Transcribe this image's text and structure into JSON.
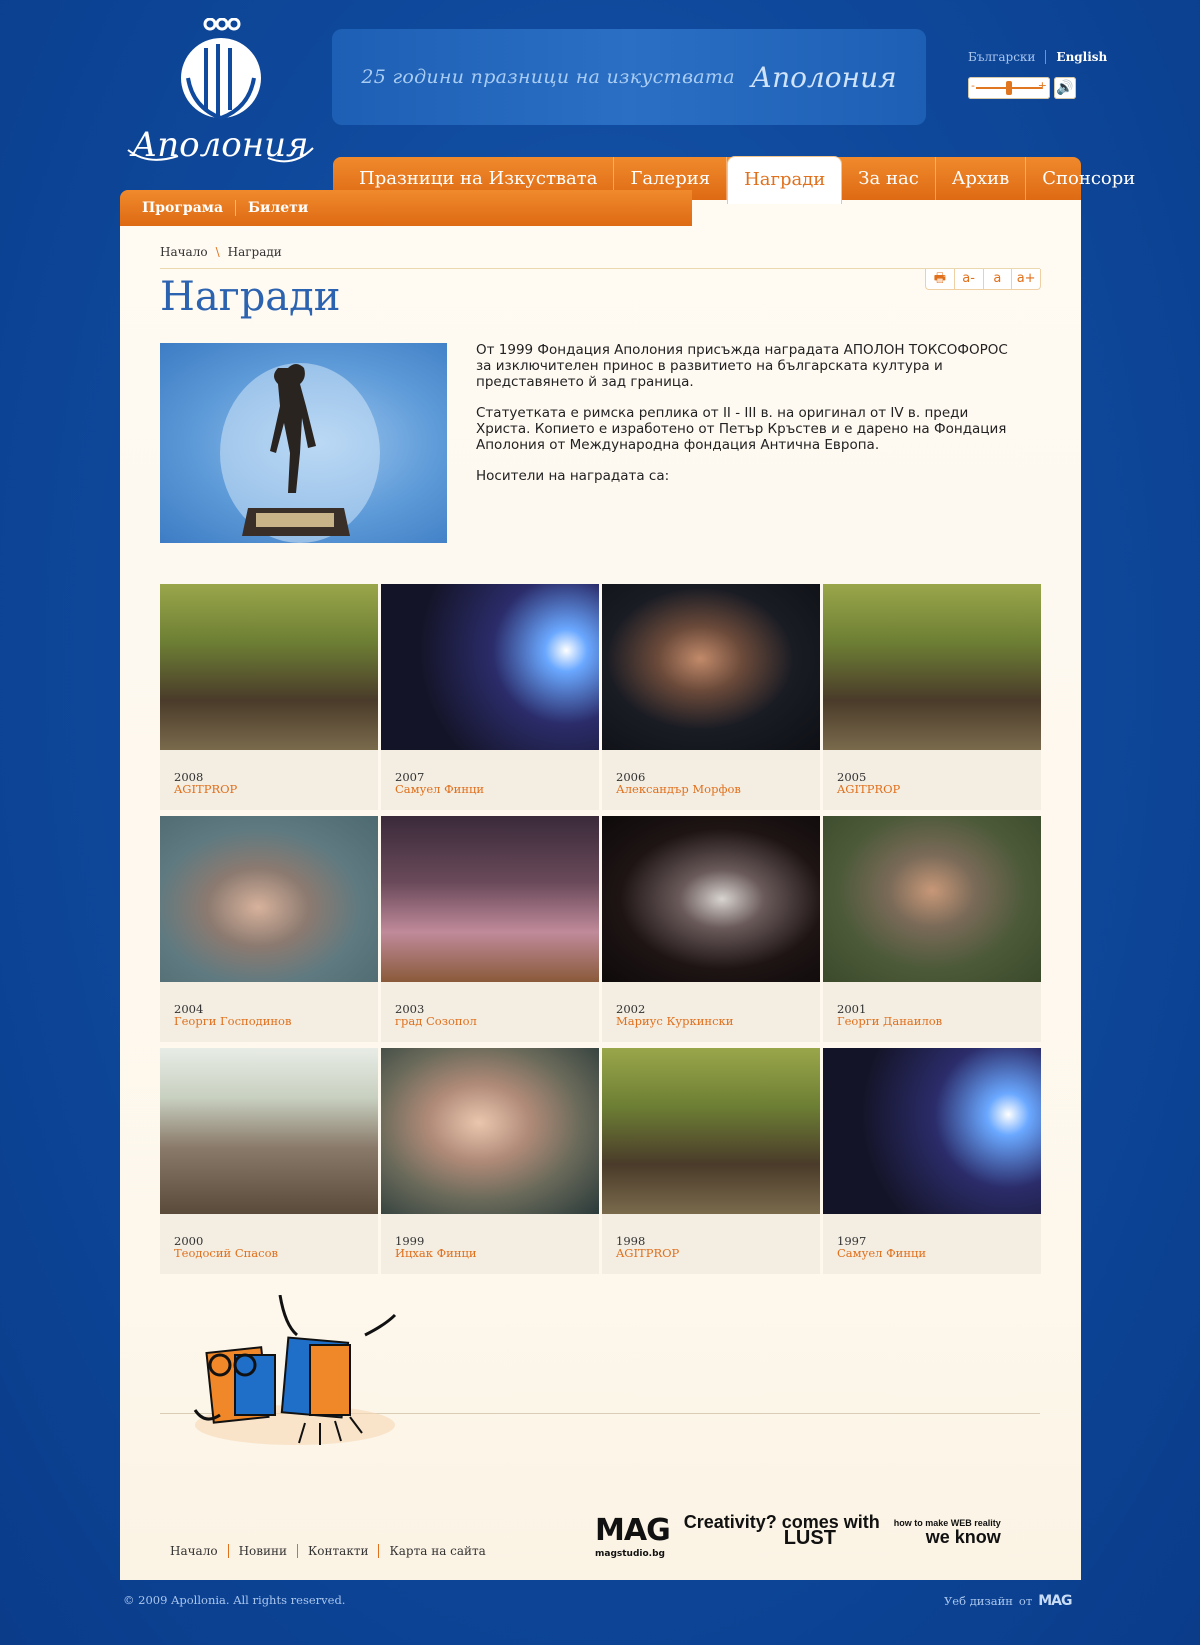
{
  "site": {
    "logo_text": "Аполония",
    "banner_text": "25 години празници на изкуствата",
    "banner_logo": "Аполония"
  },
  "lang": {
    "bg": "Български",
    "en": "English"
  },
  "main_nav": [
    "Празници на Изкуствата",
    "Галерия",
    "Награди",
    "За нас",
    "Архив",
    "Спонсори"
  ],
  "main_nav_active": "Награди",
  "sub_nav": [
    "Програма",
    "Билети"
  ],
  "breadcrumb": {
    "home": "Начало",
    "current": "Награди"
  },
  "tools": {
    "print": "🖶",
    "smaller": "a-",
    "normal": "a",
    "larger": "a+"
  },
  "page": {
    "title": "Награди",
    "p1": "От 1999 Фондация Аполония присъжда наградата АПОЛОН ТОКСОФОРОС за изключителен принос в развитието на българската култура и представянето й зад граница.",
    "p2": "Статуетката е римска реплика от II - III в. на оригинал от IV в. преди Христа. Копието е изработено от Петър Кръстев и е дарено на Фондация Аполония от Международна фондация Антична Европа.",
    "p3": "Носители на наградата са:"
  },
  "awards": [
    {
      "year": "2008",
      "name": "AGITPROP",
      "photo": "group"
    },
    {
      "year": "2007",
      "name": "Самуел Финци",
      "photo": "stage"
    },
    {
      "year": "2006",
      "name": "Александър Морфов",
      "photo": "portrait-dark"
    },
    {
      "year": "2005",
      "name": "AGITPROP",
      "photo": "group"
    },
    {
      "year": "2004",
      "name": "Георги Господинов",
      "photo": "portrait-rock"
    },
    {
      "year": "2003",
      "name": "град Созопол",
      "photo": "ceremony"
    },
    {
      "year": "2002",
      "name": "Мариус Куркински",
      "photo": "handshake"
    },
    {
      "year": "2001",
      "name": "Георги Данаилов",
      "photo": "portrait-green"
    },
    {
      "year": "2000",
      "name": "Теодосий Спасов",
      "photo": "outdoor"
    },
    {
      "year": "1999",
      "name": "Ицхак Финци",
      "photo": "portrait-old"
    },
    {
      "year": "1998",
      "name": "AGITPROP",
      "photo": "group"
    },
    {
      "year": "1997",
      "name": "Самуел Финци",
      "photo": "stage"
    }
  ],
  "footer": {
    "links": [
      "Начало",
      "Новини",
      "Контакти",
      "Карта на сайта"
    ],
    "copyright": "© 2009 Apollonia. All rights reserved.",
    "design_label": "Уеб дизайн",
    "design_by": "от",
    "mag_logo": "MAG",
    "mag_caption": "magstudio.bg",
    "creativity_1": "Creativity? comes with",
    "creativity_2": "LUST",
    "weknow_small": "how to make WEB reality",
    "weknow": "we know"
  },
  "colors": {
    "brand_blue": "#0f4a9e",
    "accent_orange": "#e0701c",
    "title_blue": "#2c63b0"
  }
}
